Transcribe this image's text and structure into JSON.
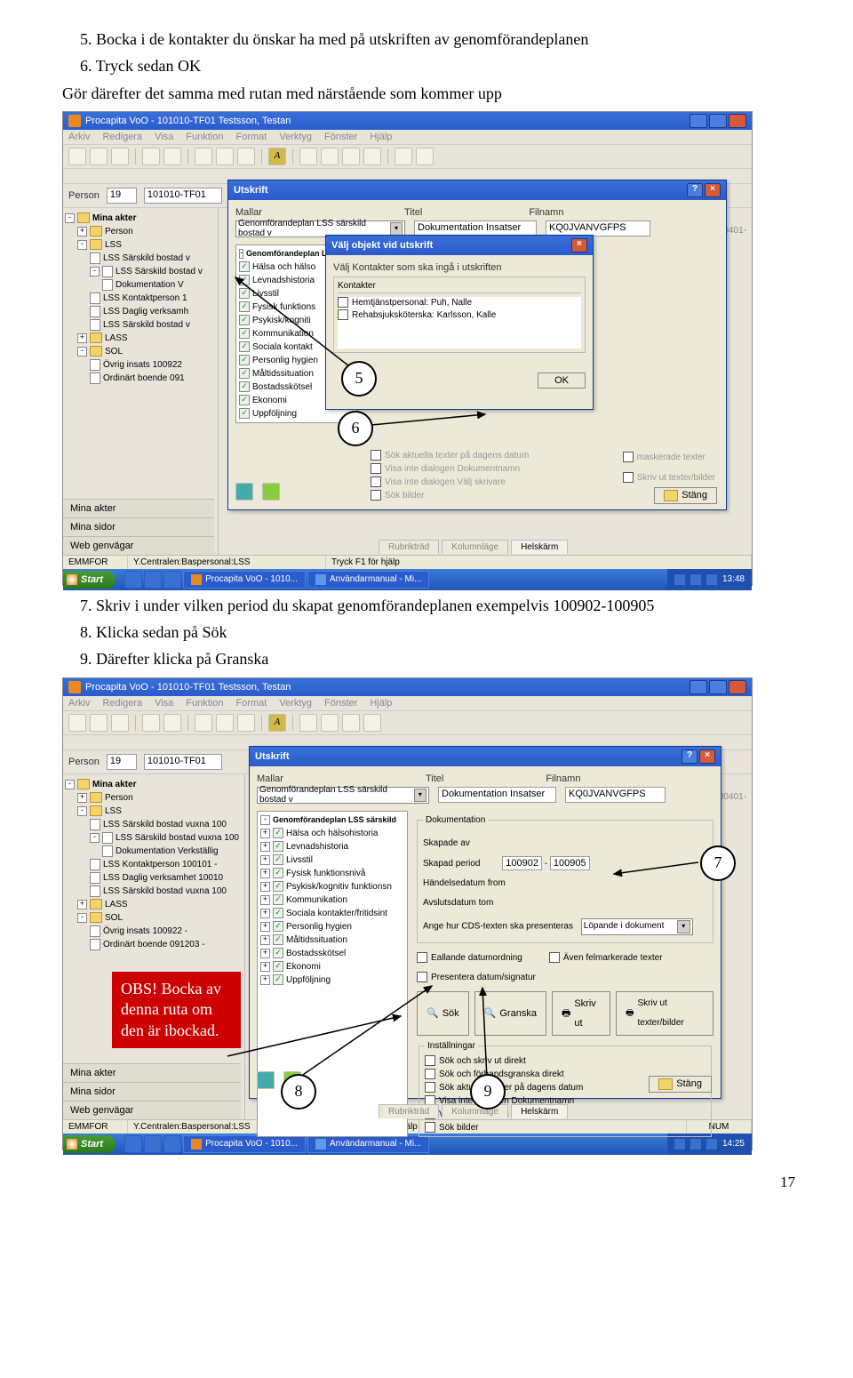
{
  "instructions": {
    "i5": "5.   Bocka i de kontakter du önskar ha med på utskriften av genomförandeplanen",
    "i6": "6.   Tryck sedan OK",
    "gor": "Gör därefter det samma med rutan med närstående som kommer upp",
    "i7": "7.   Skriv i under vilken period du skapat genomförandeplanen exempelvis 100902-100905",
    "i8": "8.   Klicka sedan på Sök",
    "i9": "9.   Därefter klicka på Granska"
  },
  "callouts": {
    "c5": "5",
    "c6": "6",
    "c7": "7",
    "c8": "8",
    "c9": "9"
  },
  "red_note": "OBS! Bocka av denna ruta om den är ibockad.",
  "app_window": {
    "title": "Procapita VoO - 101010-TF01 Testsson, Testan",
    "menus": [
      "Arkiv",
      "Redigera",
      "Visa",
      "Funktion",
      "Format",
      "Verktyg",
      "Fönster",
      "Hjälp"
    ],
    "person_label": "Person",
    "person_code": "19",
    "person_id": "101010-TF01",
    "aside": "d vuxna 20100401-",
    "aside2": "20100401-"
  },
  "tree": {
    "root": "Mina akter",
    "items": [
      {
        "t": "Person",
        "node": true
      },
      {
        "t": "LSS",
        "node": true
      },
      {
        "t": "LSS Särskild bostad v",
        "lvl": 2
      },
      {
        "t": "LSS Särskild bostad v",
        "lvl": 2
      },
      {
        "t": "Dokumentation V",
        "lvl": 3
      },
      {
        "t": "LSS Kontaktperson 1",
        "lvl": 2
      },
      {
        "t": "LSS Daglig verksamh",
        "lvl": 2
      },
      {
        "t": "LSS Särskild bostad v",
        "lvl": 2
      },
      {
        "t": "LASS",
        "node": true
      },
      {
        "t": "SOL",
        "node": true
      },
      {
        "t": "Övrig insats 100922",
        "lvl": 2
      },
      {
        "t": "Ordinärt boende 091"
      }
    ]
  },
  "tree2": {
    "root": "Mina akter",
    "items": [
      {
        "t": "Person",
        "node": true
      },
      {
        "t": "LSS",
        "node": true
      },
      {
        "t": "LSS Särskild bostad vuxna 100",
        "lvl": 2
      },
      {
        "t": "LSS Särskild bostad vuxna 100",
        "lvl": 2
      },
      {
        "t": "Dokumentation Verkställig",
        "lvl": 3
      },
      {
        "t": "LSS Kontaktperson 100101 -",
        "lvl": 2
      },
      {
        "t": "LSS Daglig verksamhet 10010",
        "lvl": 2
      },
      {
        "t": "LSS Särskild bostad vuxna 100",
        "lvl": 2
      },
      {
        "t": "LASS",
        "node": true
      },
      {
        "t": "SOL",
        "node": true
      },
      {
        "t": "Övrig insats 100922 -",
        "lvl": 2
      },
      {
        "t": "Ordinärt boende 091203 -"
      }
    ]
  },
  "utskrift": {
    "title": "Utskrift",
    "mallar_label": "Mallar",
    "mallar_value": "Genomförandeplan LSS särskild bostad v",
    "mallar_value2": "Genomförandeplan LSS särskild bostad v",
    "titel_label": "Titel",
    "titel_value": "Dokumentation Insatser",
    "filnamn_label": "Filnamn",
    "filnamn_value": "KQ0JVANVGFPS",
    "list_header": "Genomförandeplan LSS särskild bost.",
    "list_header2": "Genomförandeplan LSS särskild",
    "list": [
      "Hälsa och hälso",
      "Levnadshistoria",
      "Livsstil",
      "Fysisk funktions",
      "Psykisk/kogniti",
      "Kommunikation",
      "Sociala kontakt",
      "Personlig hygien",
      "Måltidssituation",
      "Bostadsskötsel",
      "Ekonomi",
      "Uppföljning"
    ],
    "list2": [
      "Hälsa och hälsohistoria",
      "Levnadshistoria",
      "Livsstil",
      "Fysisk funktionsnivå",
      "Psykisk/kognitiv funktionsn",
      "Kommunikation",
      "Sociala kontakter/fritidsint",
      "Personlig hygien",
      "Måltidssituation",
      "Bostadsskötsel",
      "Ekonomi",
      "Uppföljning"
    ],
    "stang": "Stäng",
    "doc_section": "Dokumentation",
    "skapad_av": "Skapade av",
    "skapad_period": "Skapad period",
    "period_from": "100902",
    "period_to": "100905",
    "handelse": "Händelsedatum from",
    "avslut": "Avslutsdatum tom",
    "ange": "Ange hur CDS-texten ska presenteras",
    "ange_val": "Löpande i dokument",
    "cb_fallande": "Eallande datumordning",
    "cb_aven": "Även felmarkerade texter",
    "cb_presentera": "Presentera datum/signatur",
    "cb_maskerade": "maskerade texter",
    "cb_skrivut": "Skriv ut texter/bilder",
    "btn_sok": "Sök",
    "btn_granska": "Granska",
    "btn_skriv": "Skriv ut",
    "btn_skriv_texter": "Skriv ut texter/bilder",
    "inst_label": "Inställningar",
    "inst": [
      "Sök och skriv ut direkt",
      "Sök och förhandsgranska direkt",
      "Sök aktuella texter på dagens datum",
      "Visa inte dialogen Dokumentnamn",
      "Visa inte dialogen Välj skrivare",
      "Sök bilder"
    ],
    "gray_opts": [
      "Sök aktuella texter på dagens datum",
      "Visa inte dialogen Dokumentnamn",
      "Visa inte dialogen Välj skrivare",
      "Sök bilder"
    ]
  },
  "valj": {
    "title": "Välj objekt vid utskrift",
    "subtitle": "Välj Kontakter som ska ingå i utskriften",
    "group": "Kontakter",
    "opt1": "Hemtjänstpersonal:   Puh, Nalle",
    "opt2": "Rehabsjuksköterska:   Karlsson, Kalle",
    "ok": "OK"
  },
  "sidepanel": {
    "mina_akter": "Mina akter",
    "mina_sidor": "Mina sidor",
    "web": "Web genvägar"
  },
  "footer_tabs": {
    "rubrik": "Rubrikträd",
    "kolumn": "Kolumnläge",
    "helskarm": "Helskärm"
  },
  "statusbar": {
    "left": "EMMFOR",
    "center": "Y.Centralen:Baspersonal:LSS",
    "hint": "Tryck F1 för hjälp",
    "num": "NUM"
  },
  "taskbar": {
    "start": "Start",
    "items": [
      {
        "label": "Procapita VoO - 1010..."
      },
      {
        "label": "Användarmanual - Mi..."
      }
    ],
    "time1": "13:48",
    "time2": "14:25"
  },
  "page_number": "17"
}
